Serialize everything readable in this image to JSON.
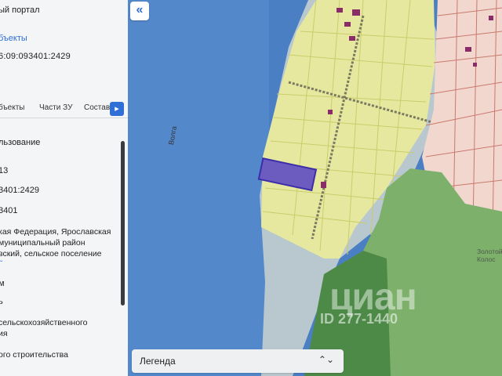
{
  "panel": {
    "portal_title": "ый портал",
    "objects_link": "бъекты",
    "cadastral_number": "6:09:093401:2429",
    "tabs": [
      "бъекты",
      "Части ЗУ",
      "Состав"
    ],
    "tab_scroll_icon": "chevron-right-icon",
    "rows": [
      "льзование",
      "13",
      "3401:2429",
      "3401",
      "кая Федерация, Ярославская",
      "муниципальный район",
      "вский, сельское поселение",
      "м",
      "ь",
      "сельскохозяйственного",
      "ия",
      "ого строительства"
    ],
    "expand_icon": "chevron-down-icon"
  },
  "map": {
    "collapse_icon": "double-chevron-left-icon",
    "river_label": "Волга",
    "place_label_1": "Золотой",
    "place_label_2": "Колос",
    "legend_label": "Легенда",
    "legend_icon": "updown-chevron-icon",
    "watermark": "циан",
    "watermark_id": "ID 277-1440",
    "colors": {
      "water": "#4a7fc4",
      "settlement_parcels": "#e7e8a0",
      "forest": "#7db06a",
      "urban_parcels": "#f2d7cf",
      "selected_parcel": "#6d5cc0",
      "buildings": "#8a2c6a"
    }
  }
}
